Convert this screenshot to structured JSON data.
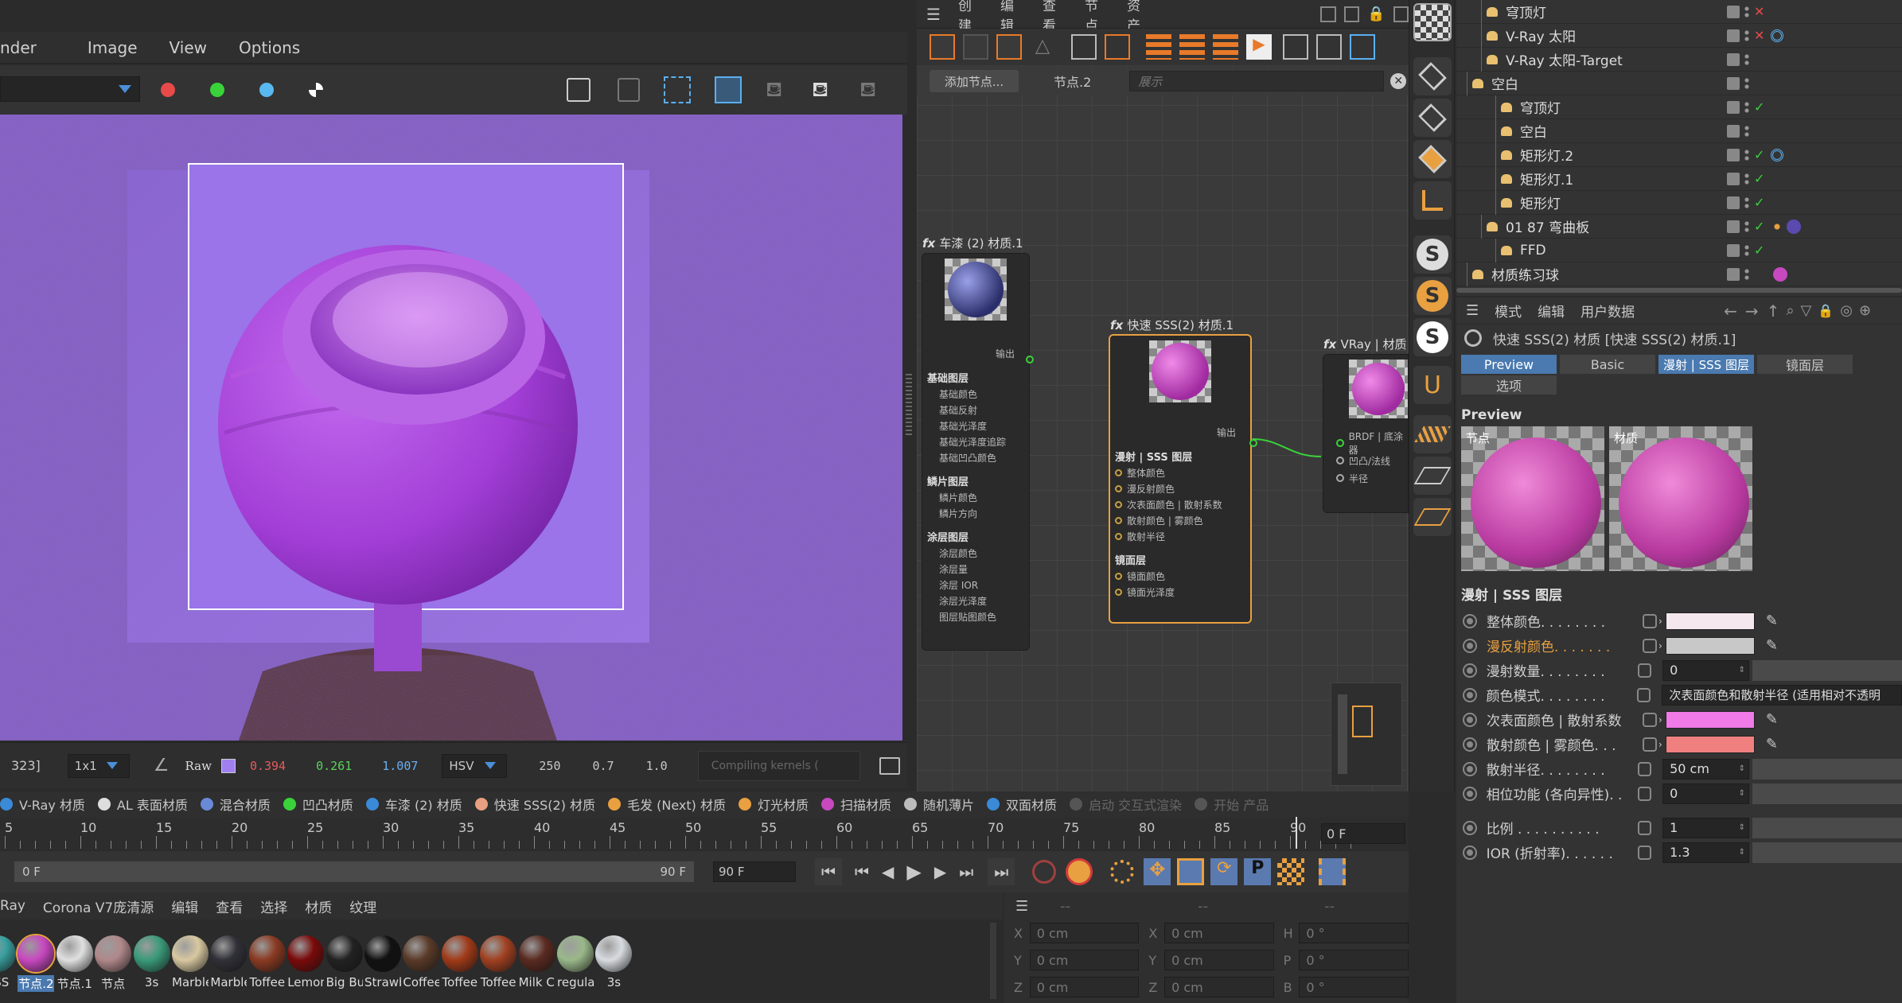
{
  "render_window": {
    "menu": [
      "nder",
      "Image",
      "View",
      "Options"
    ],
    "status": {
      "coord": "323]",
      "sample": "1x1",
      "mode": "Raw",
      "r": "0.394",
      "g": "0.261",
      "b": "1.007",
      "space": "HSV",
      "h": "250",
      "s": "0.7",
      "v": "1.0",
      "compile": "Compiling kernels ("
    }
  },
  "node_editor": {
    "menu": [
      "创建",
      "编辑",
      "查看",
      "节点",
      "资产"
    ],
    "add_node_button": "添加节点...",
    "current_node": "节点.2",
    "search_placeholder": "展示",
    "nodes": [
      {
        "title": "车漆 (2) 材质.1",
        "output": "输出",
        "sections": [
          {
            "name": "基础图层",
            "ports": [
              "基础颜色",
              "基础反射",
              "基础光泽度",
              "基础光泽度追踪",
              "基础凹凸颜色"
            ]
          },
          {
            "name": "鳞片图层",
            "ports": [
              "鳞片颜色",
              "鳞片方向"
            ]
          },
          {
            "name": "涂层图层",
            "ports": [
              "涂层颜色",
              "涂层量",
              "涂层 IOR",
              "涂层光泽度",
              "图层贴图颜色"
            ]
          }
        ]
      },
      {
        "title": "快速 SSS(2) 材质.1",
        "output": "输出",
        "sections": [
          {
            "name": "漫射 | SSS 图层",
            "ports": [
              "整体颜色",
              "漫反射颜色",
              "次表面颜色 | 散射系数",
              "散射颜色 | 雾颜色",
              "散射半径"
            ]
          },
          {
            "name": "镜面层",
            "ports": [
              "镜面颜色",
              "镜面光泽度"
            ]
          }
        ]
      },
      {
        "title": "VRay | 材质",
        "ports": [
          "BRDF | 底涂器",
          "凹凸/法线",
          "半径"
        ]
      }
    ]
  },
  "object_manager": {
    "rows": [
      {
        "name": "穹顶灯",
        "indent": 1,
        "status": "x"
      },
      {
        "name": "V-Ray 太阳",
        "indent": 1,
        "status": "x",
        "tag": "target"
      },
      {
        "name": "V-Ray 太阳-Target",
        "indent": 1,
        "status": ""
      },
      {
        "name": "空白",
        "indent": 0,
        "status": ""
      },
      {
        "name": "穹顶灯",
        "indent": 2,
        "status": "check"
      },
      {
        "name": "空白",
        "indent": 2,
        "status": ""
      },
      {
        "name": "矩形灯.2",
        "indent": 2,
        "status": "check",
        "tag": "target"
      },
      {
        "name": "矩形灯.1",
        "indent": 2,
        "status": "check"
      },
      {
        "name": "矩形灯",
        "indent": 2,
        "status": "check"
      },
      {
        "name": "01 87 弯曲板",
        "indent": 1,
        "status": "check",
        "tag": "ball"
      },
      {
        "name": "FFD",
        "indent": 2,
        "status": "check"
      },
      {
        "name": "材质练习球",
        "indent": 0,
        "status": "",
        "tag": "pink"
      }
    ]
  },
  "attributes": {
    "menu": [
      "模式",
      "编辑",
      "用户数据"
    ],
    "title": "快速 SSS(2) 材质 [快速 SSS(2) 材质.1]",
    "tabs": [
      "Preview",
      "Basic",
      "漫射 | SSS 图层",
      "镜面层",
      "选项"
    ],
    "preview_label": "Preview",
    "preview_captions": [
      "节点",
      "材质"
    ],
    "section": "漫射 | SSS 图层",
    "rows": [
      {
        "label": "整体颜色. . . . . . . .",
        "type": "color",
        "color": "#f4e8ee"
      },
      {
        "label": "漫反射颜色. . . . . . .",
        "type": "color",
        "color": "#c8c8c8",
        "highlight": true
      },
      {
        "label": "漫射数量. . . . . . . .",
        "type": "num",
        "value": "0"
      },
      {
        "label": "颜色模式. . . . . . . .",
        "type": "text",
        "value": "次表面颜色和散射半径 (适用相对不透明"
      },
      {
        "label": "次表面颜色 | 散射系数",
        "type": "color",
        "color": "#f07ae6"
      },
      {
        "label": "散射颜色 | 雾颜色. . .",
        "type": "color",
        "color": "#f08080"
      },
      {
        "label": "散射半径. . . . . . . .",
        "type": "num",
        "value": "50 cm"
      },
      {
        "label": "相位功能 (各向异性). .",
        "type": "num",
        "value": "0"
      },
      {
        "label": "比例 . . . . . . . . . .",
        "type": "num",
        "value": "1"
      },
      {
        "label": "IOR (折射率). . . . . .",
        "type": "num",
        "value": "1.3"
      }
    ]
  },
  "material_tabs": [
    "V-Ray 材质",
    "AL 表面材质",
    "混合材质",
    "凹凸材质",
    "车漆 (2) 材质",
    "快速 SSS(2) 材质",
    "毛发 (Next) 材质",
    "灯光材质",
    "扫描材质",
    "随机薄片",
    "双面材质",
    "启动 交互式渲染",
    "开始 产品"
  ],
  "timeline": {
    "ticks": [
      "5",
      "10",
      "15",
      "20",
      "25",
      "30",
      "35",
      "40",
      "45",
      "50",
      "55",
      "60",
      "65",
      "70",
      "75",
      "80",
      "85",
      "90"
    ],
    "frame_field": "0 F",
    "range_start": "0 F",
    "range_end": "90 F",
    "range_end_field": "90 F"
  },
  "material_manager": {
    "menu": [
      "Ray",
      "Corona V7庞清源",
      "编辑",
      "查看",
      "选择",
      "材质",
      "纹理"
    ],
    "swatches": [
      {
        "label": "SSS",
        "color": "#3aa0a0"
      },
      {
        "label": "节点.2",
        "color": "#c848c0",
        "selected": true
      },
      {
        "label": "节点.1",
        "color": "#e0e0e0"
      },
      {
        "label": "节点",
        "color": "#b0888a"
      },
      {
        "label": "3s",
        "color": "#3a9a7a"
      },
      {
        "label": "Marble",
        "color": "#d8c8a0"
      },
      {
        "label": "Marble",
        "color": "#303038"
      },
      {
        "label": "Toffee",
        "color": "#8a3a22"
      },
      {
        "label": "Lemon j",
        "color": "#7a0a0a"
      },
      {
        "label": "Big Bub",
        "color": "#222"
      },
      {
        "label": "Strawbe",
        "color": "#111"
      },
      {
        "label": "Coffee I",
        "color": "#5a3a28"
      },
      {
        "label": "Toffee",
        "color": "#a03a18"
      },
      {
        "label": "Toffee",
        "color": "#a04020"
      },
      {
        "label": "Milk Ch",
        "color": "#5a2a20"
      },
      {
        "label": "regular",
        "color": "#9ab88a"
      },
      {
        "label": "3s",
        "color": "#d8dce0"
      }
    ]
  },
  "coords": {
    "rows": [
      {
        "a": "X",
        "av": "0 cm",
        "b": "X",
        "bv": "0 cm",
        "c": "H",
        "cv": "0 °"
      },
      {
        "a": "Y",
        "av": "0 cm",
        "b": "Y",
        "bv": "0 cm",
        "c": "P",
        "cv": "0 °"
      },
      {
        "a": "Z",
        "av": "0 cm",
        "b": "Z",
        "bv": "0 cm",
        "c": "B",
        "cv": "0 °"
      }
    ]
  }
}
